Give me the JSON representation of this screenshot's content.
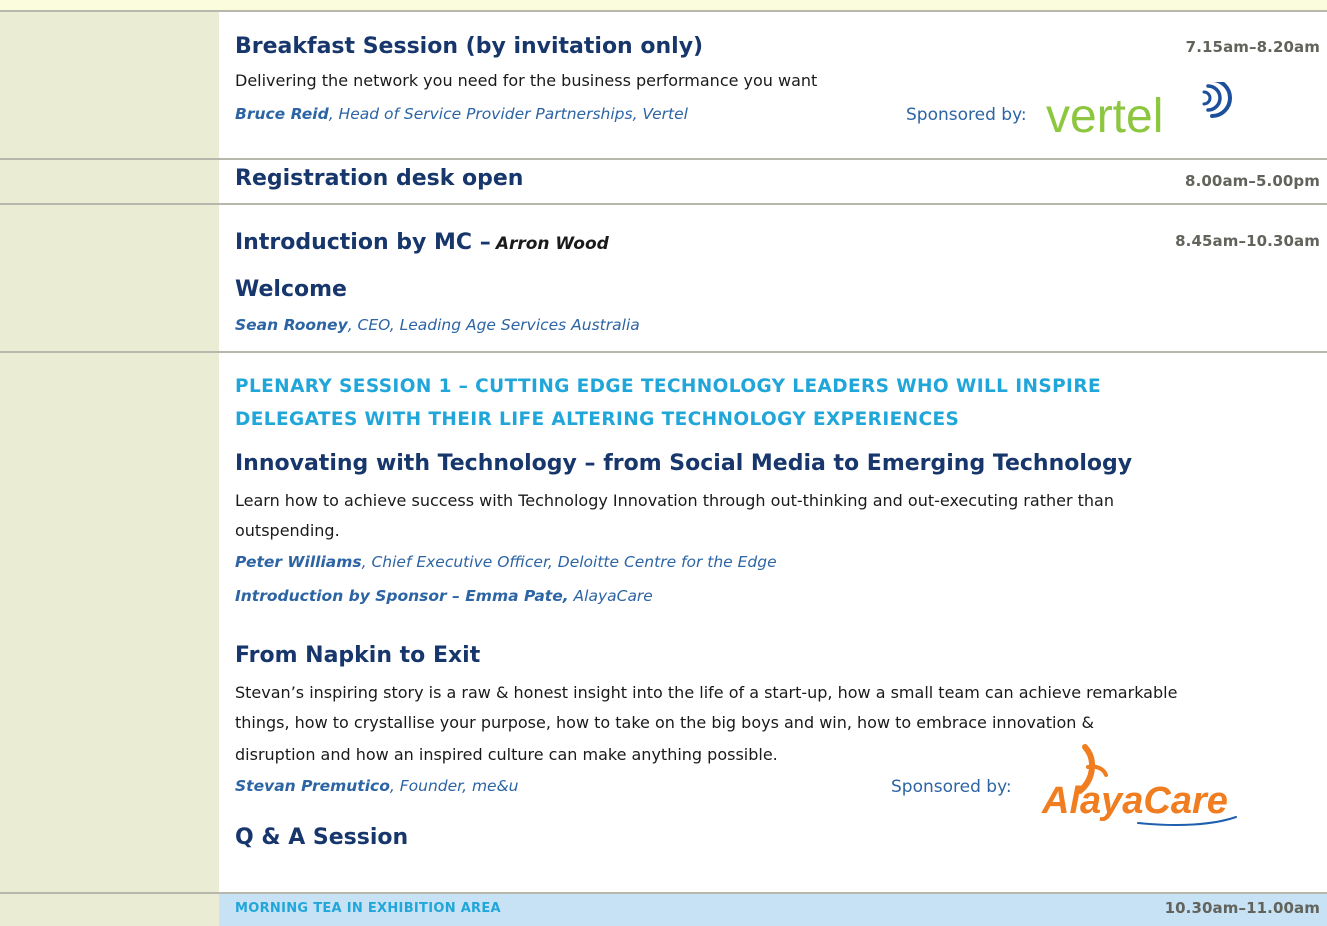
{
  "sessions": {
    "breakfast": {
      "time": "7.15am–8.20am",
      "title": "Breakfast Session (by invitation only)",
      "description": "Delivering the network you need for the business performance you want",
      "speaker_name": "Bruce Reid",
      "speaker_role": ", Head of Service Provider Partnerships, Vertel",
      "sponsored_label": "Sponsored by:",
      "sponsor_logo_text": "vertel"
    },
    "registration": {
      "time": "8.00am–5.00pm",
      "title": "Registration desk open"
    },
    "intro": {
      "time": "8.45am–10.30am",
      "title": "Introduction by MC –",
      "mc_name": "Arron Wood",
      "welcome_title": "Welcome",
      "speaker_name": "Sean Rooney",
      "speaker_role": ", CEO, Leading Age Services Australia"
    },
    "plenary": {
      "heading_line1": "PLENARY SESSION 1 – CUTTING EDGE TECHNOLOGY LEADERS WHO WILL INSPIRE",
      "heading_line2": "DELEGATES WITH THEIR LIFE ALTERING TECHNOLOGY EXPERIENCES",
      "talk1_title": "Innovating with Technology – from Social Media to Emerging Technology",
      "talk1_desc_line1": "Learn how to achieve success with Technology Innovation through out-thinking and out-executing rather than",
      "talk1_desc_line2": "outspending.",
      "talk1_speaker_name": "Peter Williams",
      "talk1_speaker_role": ", Chief Executive Officer, Deloitte Centre for the Edge",
      "sponsor_intro_bold": "Introduction by Sponsor – Emma Pate,",
      "sponsor_intro_org": " AlayaCare",
      "talk2_title": "From Napkin to Exit",
      "talk2_desc_line1": "Stevan’s inspiring story is a raw & honest insight into the life of a start-up, how a small team can achieve remarkable",
      "talk2_desc_line2": "things, how to crystallise your purpose, how to take on the big boys and win, how to embrace innovation &",
      "talk2_desc_line3": "disruption and how an inspired culture can make anything possible.",
      "talk2_speaker_name": "Stevan Premutico",
      "talk2_speaker_role": ", Founder, me&u",
      "sponsored_label": "Sponsored by:",
      "sponsor_logo_text": "AlayaCare",
      "qa_title": "Q & A Session"
    },
    "tea": {
      "time": "10.30am–11.00am",
      "label": "MORNING TEA IN EXHIBITION AREA"
    }
  },
  "colors": {
    "title": "#17366b",
    "speaker": "#2c64a4",
    "plenary": "#21a6da",
    "vertel_green": "#8dc63f",
    "vertel_blue": "#1c4f9c",
    "alayacare_orange": "#f07d1f",
    "alayacare_blue": "#1f5fb0"
  }
}
